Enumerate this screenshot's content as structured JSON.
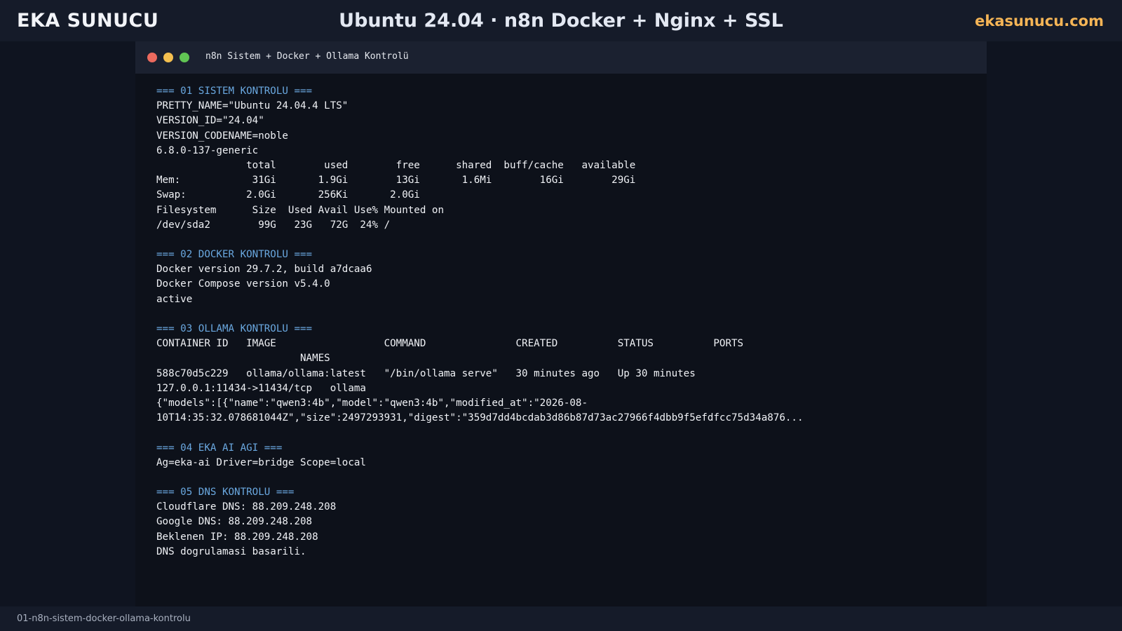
{
  "header": {
    "brand": "EKA SUNUCU",
    "title": "Ubuntu 24.04 · n8n Docker + Nginx + SSL",
    "site": "ekasunucu.com"
  },
  "terminal": {
    "window_title": "n8n Sistem + Docker + Ollama Kontrolü",
    "lines": [
      {
        "text": "=== 01 SISTEM KONTROLU ===",
        "header": true
      },
      {
        "text": "PRETTY_NAME=\"Ubuntu 24.04.4 LTS\""
      },
      {
        "text": "VERSION_ID=\"24.04\""
      },
      {
        "text": "VERSION_CODENAME=noble"
      },
      {
        "text": "6.8.0-137-generic"
      },
      {
        "text": "               total        used        free      shared  buff/cache   available"
      },
      {
        "text": "Mem:            31Gi       1.9Gi        13Gi       1.6Mi        16Gi        29Gi"
      },
      {
        "text": "Swap:          2.0Gi       256Ki       2.0Gi"
      },
      {
        "text": "Filesystem      Size  Used Avail Use% Mounted on"
      },
      {
        "text": "/dev/sda2        99G   23G   72G  24% /"
      },
      {
        "text": ""
      },
      {
        "text": "=== 02 DOCKER KONTROLU ===",
        "header": true
      },
      {
        "text": "Docker version 29.7.2, build a7dcaa6"
      },
      {
        "text": "Docker Compose version v5.4.0"
      },
      {
        "text": "active"
      },
      {
        "text": ""
      },
      {
        "text": "=== 03 OLLAMA KONTROLU ===",
        "header": true
      },
      {
        "text": "CONTAINER ID   IMAGE                  COMMAND               CREATED          STATUS          PORTS"
      },
      {
        "text": "                        NAMES"
      },
      {
        "text": "588c70d5c229   ollama/ollama:latest   \"/bin/ollama serve\"   30 minutes ago   Up 30 minutes"
      },
      {
        "text": "127.0.0.1:11434->11434/tcp   ollama"
      },
      {
        "text": "{\"models\":[{\"name\":\"qwen3:4b\",\"model\":\"qwen3:4b\",\"modified_at\":\"2026-08-"
      },
      {
        "text": "10T14:35:32.078681044Z\",\"size\":2497293931,\"digest\":\"359d7dd4bcdab3d86b87d73ac27966f4dbb9f5efdfcc75d34a876..."
      },
      {
        "text": ""
      },
      {
        "text": "=== 04 EKA AI AGI ===",
        "header": true
      },
      {
        "text": "Ag=eka-ai Driver=bridge Scope=local"
      },
      {
        "text": ""
      },
      {
        "text": "=== 05 DNS KONTROLU ===",
        "header": true
      },
      {
        "text": "Cloudflare DNS: 88.209.248.208"
      },
      {
        "text": "Google DNS: 88.209.248.208"
      },
      {
        "text": "Beklenen IP: 88.209.248.208"
      },
      {
        "text": "DNS dogrulamasi basarili."
      }
    ]
  },
  "footer": {
    "label": "01-n8n-sistem-docker-ollama-kontrolu"
  },
  "colors": {
    "accent": "#f5b556",
    "section_header": "#6aa8e0",
    "dot_close": "#ec6a5e",
    "dot_minimize": "#f4bf4f",
    "dot_maximize": "#61c554"
  }
}
